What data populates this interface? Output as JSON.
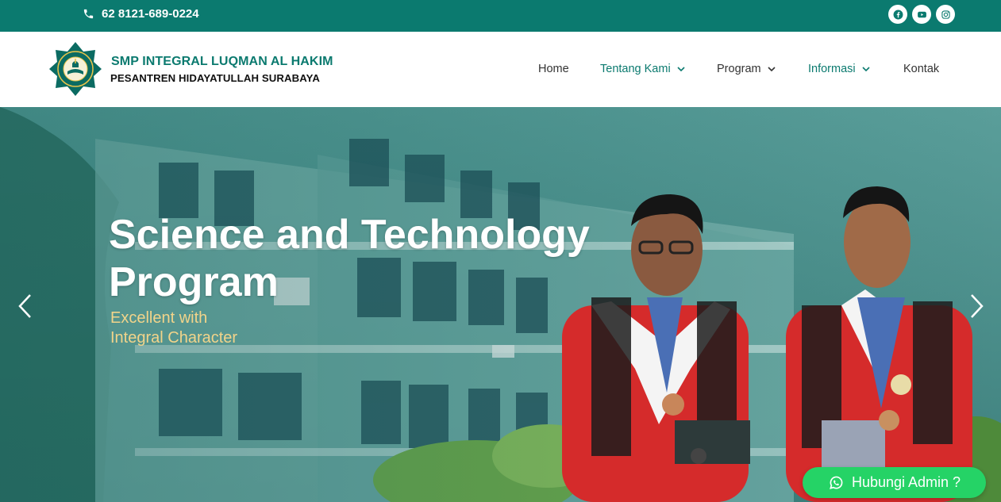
{
  "topbar": {
    "phone": "62 8121-689-0224",
    "socials": [
      "facebook-icon",
      "youtube-icon",
      "instagram-icon"
    ]
  },
  "header": {
    "school_name": "SMP INTEGRAL LUQMAN AL HAKIM",
    "school_subtitle": "PESANTREN HIDAYATULLAH SURABAYA",
    "nav": [
      {
        "label": "Home",
        "dropdown": false
      },
      {
        "label": "Tentang Kami",
        "dropdown": true
      },
      {
        "label": "Program",
        "dropdown": true
      },
      {
        "label": "Informasi",
        "dropdown": true
      },
      {
        "label": "Kontak",
        "dropdown": false
      }
    ]
  },
  "hero": {
    "title_line1": "Science and Technology",
    "title_line2": "Program",
    "subtitle_line1": "Excellent with",
    "subtitle_line2": "Integral Character"
  },
  "cta": {
    "label": "Hubungi Admin ?"
  },
  "colors": {
    "brand_teal": "#0b7a6f",
    "cta_green": "#25d366",
    "hero_subtitle": "#f2d48a"
  }
}
